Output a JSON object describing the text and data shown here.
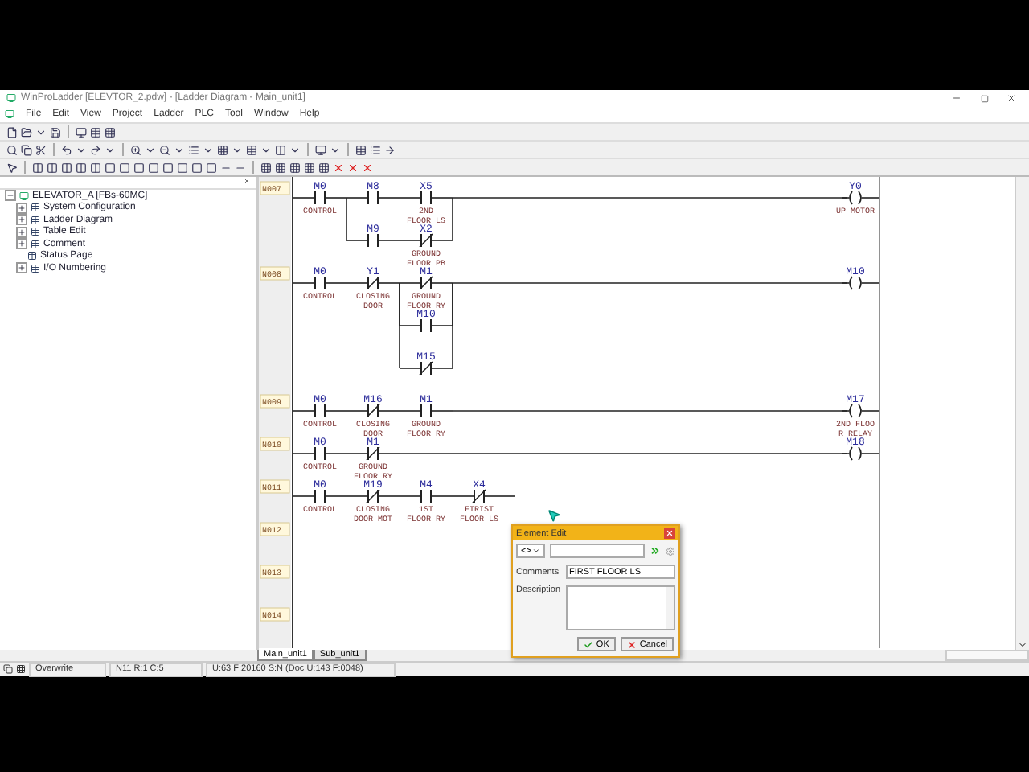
{
  "window": {
    "title": "WinProLadder [ELEVTOR_2.pdw] - [Ladder Diagram - Main_unit1]"
  },
  "menu": [
    "File",
    "Edit",
    "View",
    "Project",
    "Ladder",
    "PLC",
    "Tool",
    "Window",
    "Help"
  ],
  "project_tree": {
    "label": "ELEVATOR_A [FBs-60MC]",
    "expanded": true,
    "children": [
      {
        "label": "System Configuration",
        "expandable": true
      },
      {
        "label": "Ladder Diagram",
        "expandable": true
      },
      {
        "label": "Table Edit",
        "expandable": true
      },
      {
        "label": "Comment",
        "expandable": true
      },
      {
        "label": "Status Page",
        "expandable": false
      },
      {
        "label": "I/O Numbering",
        "expandable": true
      }
    ]
  },
  "ladder": {
    "rungs": [
      {
        "label": "N007",
        "rows": [
          [
            {
              "kind": "no",
              "name": "M0",
              "comment": [
                "CONTROL"
              ]
            },
            {
              "kind": "no",
              "name": "M8"
            },
            {
              "kind": "no",
              "name": "X5",
              "comment": [
                "2ND",
                "FLOOR LS"
              ]
            }
          ],
          [
            null,
            {
              "kind": "no",
              "name": "M9"
            },
            {
              "kind": "nc",
              "name": "X2",
              "comment": [
                "GROUND",
                "FLOOR PB"
              ]
            }
          ]
        ],
        "coil": {
          "name": "Y0",
          "comment": [
            "UP MOTOR"
          ]
        }
      },
      {
        "label": "N008",
        "rows": [
          [
            {
              "kind": "no",
              "name": "M0",
              "comment": [
                "CONTROL"
              ]
            },
            {
              "kind": "nc",
              "name": "Y1",
              "comment": [
                "CLOSING",
                "DOOR"
              ]
            },
            {
              "kind": "nc",
              "name": "M1",
              "comment": [
                "GROUND",
                "FLOOR RY"
              ]
            }
          ],
          [
            null,
            null,
            {
              "kind": "no",
              "name": "M10"
            }
          ],
          [
            null,
            null,
            {
              "kind": "nc",
              "name": "M15"
            }
          ]
        ],
        "coil": {
          "name": "M10"
        }
      },
      {
        "label": "N009",
        "rows": [
          [
            {
              "kind": "no",
              "name": "M0",
              "comment": [
                "CONTROL"
              ]
            },
            {
              "kind": "nc",
              "name": "M16",
              "comment": [
                "CLOSING",
                "DOOR"
              ]
            },
            {
              "kind": "no",
              "name": "M1",
              "comment": [
                "GROUND",
                "FLOOR RY"
              ]
            }
          ]
        ],
        "coil": {
          "name": "M17",
          "comment": [
            "2ND FLOO",
            "R RELAY"
          ]
        }
      },
      {
        "label": "N010",
        "rows": [
          [
            {
              "kind": "no",
              "name": "M0",
              "comment": [
                "CONTROL"
              ]
            },
            {
              "kind": "nc",
              "name": "M1",
              "comment": [
                "GROUND",
                "FLOOR RY"
              ]
            }
          ]
        ],
        "coil": {
          "name": "M18"
        }
      },
      {
        "label": "N011",
        "rows": [
          [
            {
              "kind": "no",
              "name": "M0",
              "comment": [
                "CONTROL"
              ]
            },
            {
              "kind": "nc",
              "name": "M19",
              "comment": [
                "CLOSING",
                "DOOR MOT"
              ]
            },
            {
              "kind": "no",
              "name": "M4",
              "comment": [
                "1ST",
                "FLOOR RY"
              ]
            },
            {
              "kind": "nc",
              "name": "X4",
              "comment": [
                "FIRIST",
                "FLOOR LS"
              ]
            }
          ]
        ]
      },
      {
        "label": "N012",
        "rows": [
          []
        ]
      },
      {
        "label": "N013",
        "rows": [
          []
        ]
      },
      {
        "label": "N014",
        "rows": [
          []
        ]
      }
    ]
  },
  "dialog": {
    "title": "Element Edit",
    "selector": "<>",
    "comments_label": "Comments",
    "comment_value": "FIRST FLOOR LS",
    "description_label": "Description",
    "buttons": [
      {
        "label": "OK",
        "kind": "ok"
      },
      {
        "label": "Cancel",
        "kind": "cancel"
      }
    ]
  },
  "tabs": [
    {
      "label": "Main_unit1",
      "selected": true
    },
    {
      "label": "Sub_unit1",
      "selected": false
    }
  ],
  "status_bar": [
    "Overwrite",
    "N11 R:1 C:5",
    "U:63 F:20160 S:N (Doc U:143 F:0048)"
  ]
}
